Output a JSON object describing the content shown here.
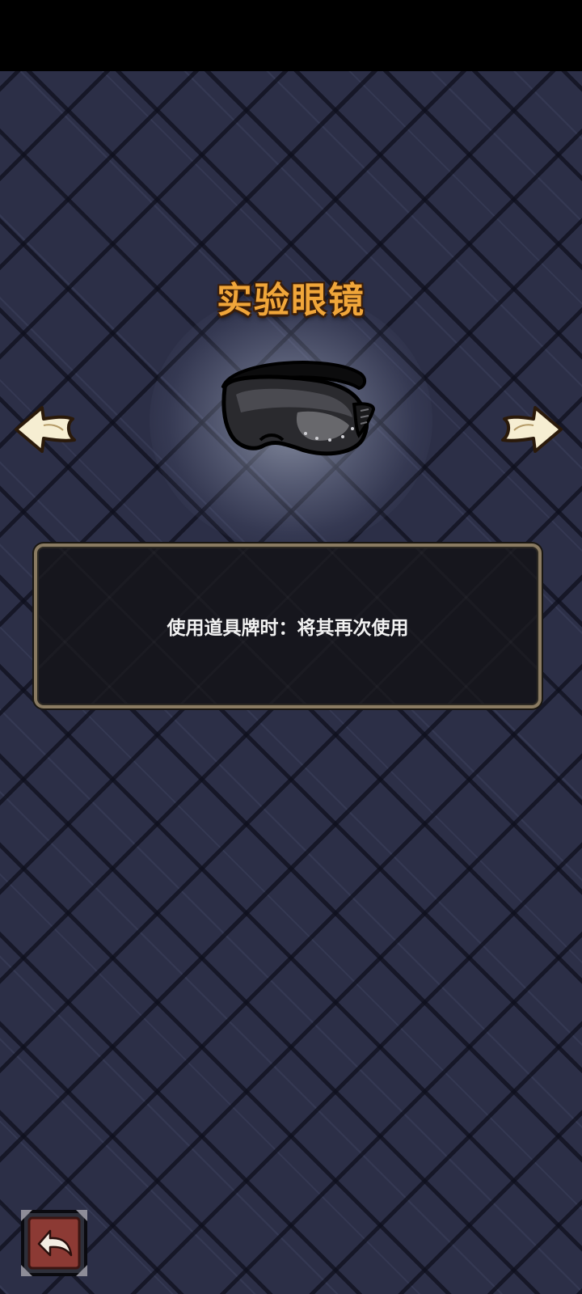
{
  "item": {
    "name": "实验眼镜",
    "description": "使用道具牌时：将其再次使用",
    "icon": "safety-goggles-icon"
  },
  "navigation": {
    "prev_icon": "left-arrow-icon",
    "next_icon": "right-arrow-icon"
  },
  "footer": {
    "back_icon": "back-return-icon"
  },
  "colors": {
    "title": "#f0a63a",
    "background": "#2c2f47",
    "panel": "#16161d",
    "panel_border": "#8a7b62",
    "arrow_fill": "#f6eed2",
    "back_button": "#8c3a34"
  }
}
